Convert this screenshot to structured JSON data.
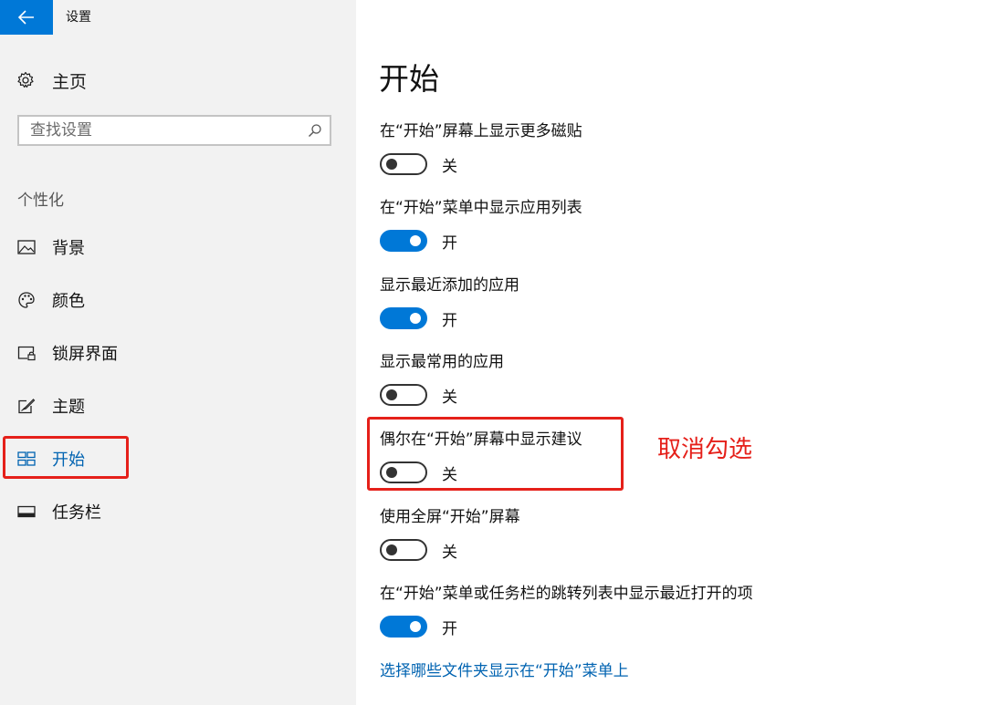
{
  "window": {
    "title": "设置"
  },
  "sidebar": {
    "home_label": "主页",
    "search_placeholder": "查找设置",
    "section_heading": "个性化",
    "items": [
      {
        "label": "背景",
        "icon": "picture-icon"
      },
      {
        "label": "颜色",
        "icon": "palette-icon"
      },
      {
        "label": "锁屏界面",
        "icon": "lock-screen-icon"
      },
      {
        "label": "主题",
        "icon": "theme-icon"
      },
      {
        "label": "开始",
        "icon": "start-tiles-icon",
        "active": true
      },
      {
        "label": "任务栏",
        "icon": "taskbar-icon"
      }
    ]
  },
  "main": {
    "title": "开始",
    "settings": [
      {
        "label": "在“开始”屏幕上显示更多磁贴",
        "state": "关",
        "on": false
      },
      {
        "label": "在“开始”菜单中显示应用列表",
        "state": "开",
        "on": true
      },
      {
        "label": "显示最近添加的应用",
        "state": "开",
        "on": true
      },
      {
        "label": "显示最常用的应用",
        "state": "关",
        "on": false
      },
      {
        "label": "偶尔在“开始”屏幕中显示建议",
        "state": "关",
        "on": false
      },
      {
        "label": "使用全屏“开始”屏幕",
        "state": "关",
        "on": false
      },
      {
        "label": "在“开始”菜单或任务栏的跳转列表中显示最近打开的项",
        "state": "开",
        "on": true
      }
    ],
    "link": "选择哪些文件夹显示在“开始”菜单上"
  },
  "annotation": {
    "text": "取消勾选"
  },
  "colors": {
    "accent": "#0078d7",
    "link": "#0063b1",
    "annotation_red": "#e5201a",
    "sidebar_bg": "#f2f2f2"
  }
}
